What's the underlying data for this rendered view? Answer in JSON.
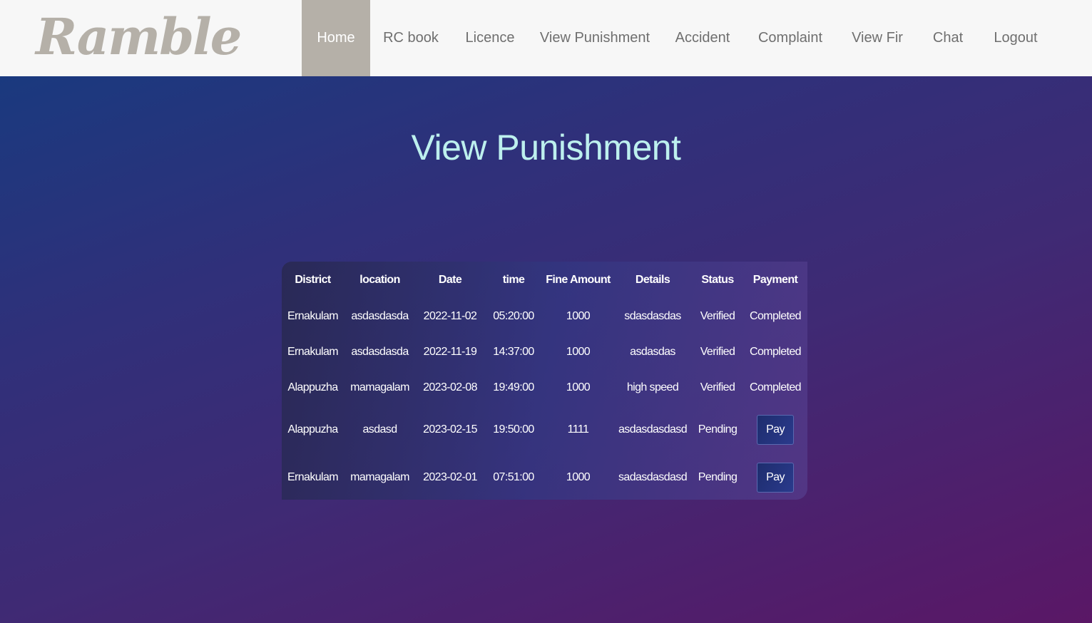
{
  "brand": "Ramble",
  "nav": [
    {
      "label": "Home",
      "active": true
    },
    {
      "label": "RC book",
      "active": false
    },
    {
      "label": "Licence",
      "active": false
    },
    {
      "label": "View Punishment",
      "active": false
    },
    {
      "label": "Accident",
      "active": false
    },
    {
      "label": "Complaint",
      "active": false
    },
    {
      "label": "View Fir",
      "active": false
    },
    {
      "label": "Chat",
      "active": false
    },
    {
      "label": "Logout",
      "active": false
    }
  ],
  "page_title": "View Punishment",
  "table": {
    "headers": [
      "District",
      "location",
      "Date",
      "time",
      "Fine Amount",
      "Details",
      "Status",
      "Payment"
    ],
    "rows": [
      {
        "district": "Ernakulam",
        "location": "asdasdasda",
        "date": "2022-11-02",
        "time": "05:20:00",
        "fine": "1000",
        "details": "sdasdasdas",
        "status": "Verified",
        "payment": "Completed"
      },
      {
        "district": "Ernakulam",
        "location": "asdasdasda",
        "date": "2022-11-19",
        "time": "14:37:00",
        "fine": "1000",
        "details": "asdasdas",
        "status": "Verified",
        "payment": "Completed"
      },
      {
        "district": "Alappuzha",
        "location": "mamagalam",
        "date": "2023-02-08",
        "time": "19:49:00",
        "fine": "1000",
        "details": "high speed",
        "status": "Verified",
        "payment": "Completed"
      },
      {
        "district": "Alappuzha",
        "location": "asdasd",
        "date": "2023-02-15",
        "time": "19:50:00",
        "fine": "1111",
        "details": "asdasdasdasd",
        "status": "Pending",
        "payment": "Pay"
      },
      {
        "district": "Ernakulam",
        "location": "mamagalam",
        "date": "2023-02-01",
        "time": "07:51:00",
        "fine": "1000",
        "details": "sadasdasdasd",
        "status": "Pending",
        "payment": "Pay"
      }
    ]
  },
  "colors": {
    "nav_active_bg": "#b5b0a8",
    "title_color": "#bdf0ee",
    "nav_text": "#6f6f6f"
  }
}
